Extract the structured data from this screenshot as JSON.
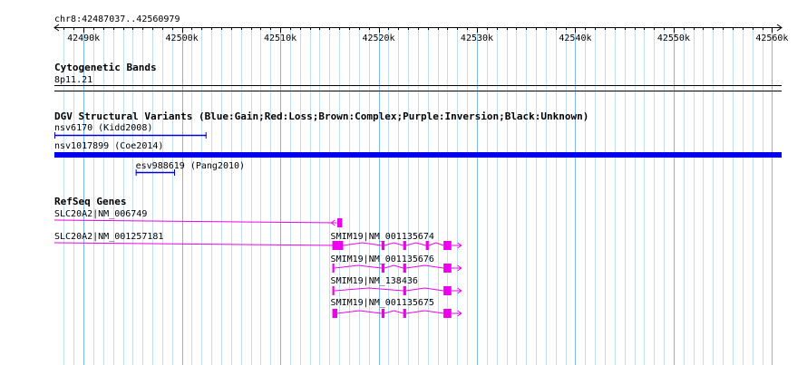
{
  "region": {
    "label": "chr8:42487037..42560979",
    "start": 42487037,
    "end": 42560979
  },
  "ruler": {
    "ticks": [
      {
        "pos": 42490000,
        "label": "42490k"
      },
      {
        "pos": 42500000,
        "label": "42500k"
      },
      {
        "pos": 42510000,
        "label": "42510k"
      },
      {
        "pos": 42520000,
        "label": "42520k"
      },
      {
        "pos": 42530000,
        "label": "42530k"
      },
      {
        "pos": 42540000,
        "label": "42540k"
      },
      {
        "pos": 42550000,
        "label": "42550k"
      },
      {
        "pos": 42560000,
        "label": "42560k"
      }
    ],
    "minor_step": 1000
  },
  "tracks": {
    "cyto": {
      "title": "Cytogenetic Bands",
      "band": "8p11.21"
    },
    "dgv": {
      "title": "DGV Structural Variants (Blue:Gain;Red:Loss;Brown:Complex;Purple:Inversion;Black:Unknown)",
      "features": [
        {
          "name": "nsv6170 (Kidd2008)",
          "start": 42487037,
          "end": 42502500,
          "color": "#0000cc",
          "style": "thin"
        },
        {
          "name": "nsv1017899 (Coe2014)",
          "start": 42487037,
          "end": 42560979,
          "color": "#0000ee",
          "style": "thick"
        },
        {
          "name": "esv988619 (Pang2010)",
          "start": 42495300,
          "end": 42499300,
          "color": "#0000cc",
          "style": "thin"
        }
      ]
    },
    "refseq": {
      "title": "RefSeq Genes",
      "color": "#ee00ee",
      "genes": [
        {
          "name": "SLC20A2|NM_006749",
          "start": 42487037,
          "end": 42516300,
          "exons": [
            [
              42515800,
              42516300
            ]
          ],
          "strand": "-"
        },
        {
          "name": "SLC20A2|NM_001257181",
          "start": 42487037,
          "end": 42516400,
          "exons": [
            [
              42515300,
              42516400
            ]
          ],
          "strand": "-"
        },
        {
          "name": "SMIM19|NM_001135674",
          "start": 42515300,
          "end": 42528400,
          "exons": [
            [
              42515300,
              42516400
            ],
            [
              42520300,
              42520600
            ],
            [
              42522500,
              42522800
            ],
            [
              42524800,
              42525100
            ],
            [
              42526600,
              42527400
            ]
          ],
          "strand": "+"
        },
        {
          "name": "SMIM19|NM_001135676",
          "start": 42515300,
          "end": 42528400,
          "exons": [
            [
              42515300,
              42515500
            ],
            [
              42520300,
              42520600
            ],
            [
              42522500,
              42522800
            ],
            [
              42526600,
              42527400
            ]
          ],
          "strand": "+"
        },
        {
          "name": "SMIM19|NM_138436",
          "start": 42515300,
          "end": 42528400,
          "exons": [
            [
              42515300,
              42515500
            ],
            [
              42522500,
              42522800
            ],
            [
              42526600,
              42527400
            ]
          ],
          "strand": "+"
        },
        {
          "name": "SMIM19|NM_001135675",
          "start": 42515300,
          "end": 42528400,
          "exons": [
            [
              42515300,
              42515800
            ],
            [
              42520300,
              42520600
            ],
            [
              42522500,
              42522800
            ],
            [
              42526600,
              42527400
            ]
          ],
          "strand": "+"
        }
      ]
    }
  }
}
